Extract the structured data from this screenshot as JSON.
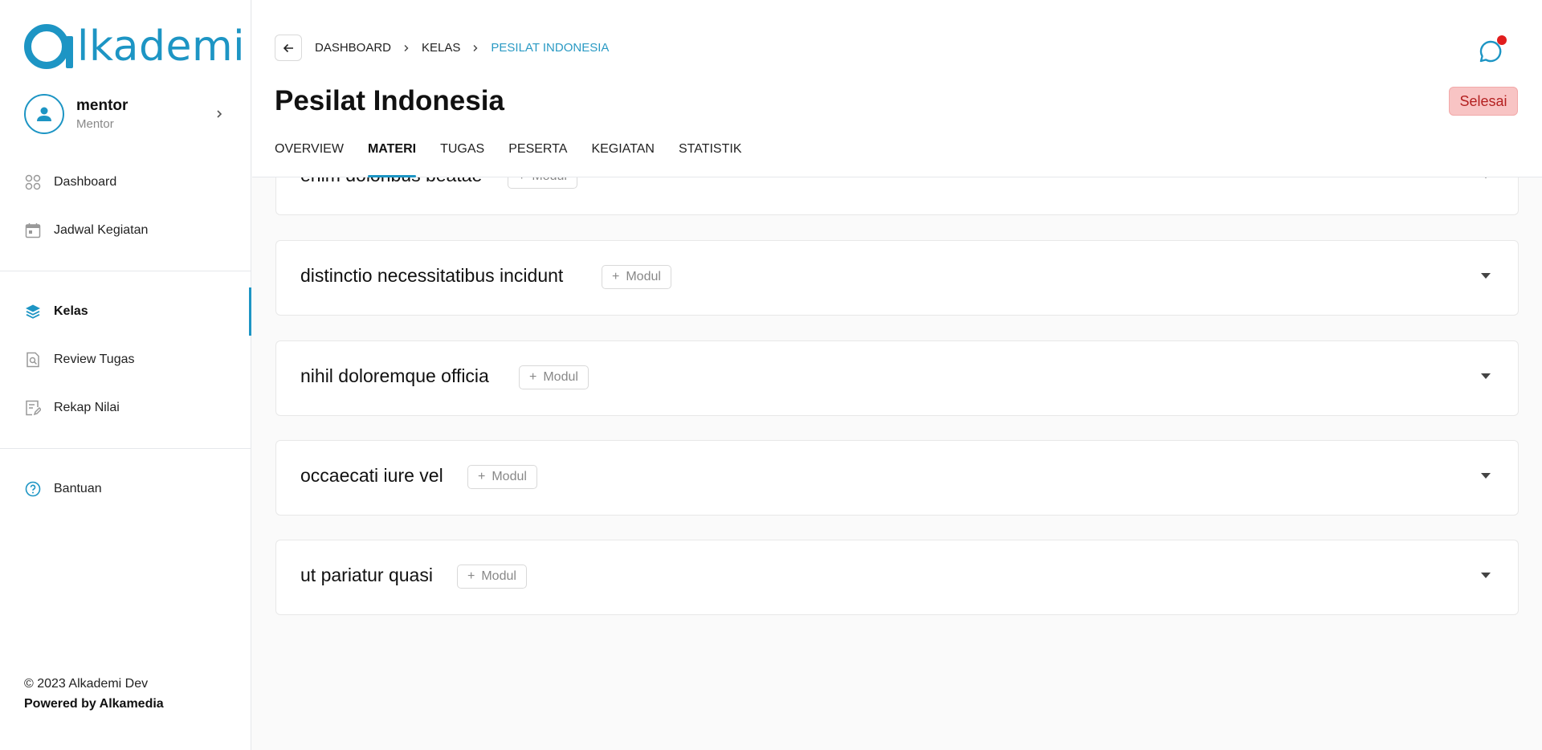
{
  "app": {
    "logo_text": "lkademi"
  },
  "user": {
    "name": "mentor",
    "role": "Mentor"
  },
  "sidebar": {
    "items": [
      {
        "label": "Dashboard",
        "icon": "grid-icon"
      },
      {
        "label": "Jadwal Kegiatan",
        "icon": "calendar-icon"
      },
      {
        "label": "Kelas",
        "icon": "layers-icon",
        "active": true
      },
      {
        "label": "Review Tugas",
        "icon": "search-document-icon"
      },
      {
        "label": "Rekap Nilai",
        "icon": "edit-document-icon"
      },
      {
        "label": "Bantuan",
        "icon": "help-circle-icon"
      }
    ],
    "footer_copy": "© 2023 Alkademi Dev",
    "footer_power": "Powered by Alkamedia"
  },
  "breadcrumb": [
    "DASHBOARD",
    "KELAS",
    "PESILAT INDONESIA"
  ],
  "page": {
    "title": "Pesilat Indonesia",
    "status": "Selesai"
  },
  "tabs": [
    "OVERVIEW",
    "MATERI",
    "TUGAS",
    "PESERTA",
    "KEGIATAN",
    "STATISTIK"
  ],
  "active_tab": "MATERI",
  "sections": [
    {
      "title": "enim doloribus beatae",
      "modul_label": "Modul"
    },
    {
      "title": "distinctio necessitatibus incidunt",
      "modul_label": "Modul"
    },
    {
      "title": "nihil doloremque officia",
      "modul_label": "Modul"
    },
    {
      "title": "occaecati iure vel",
      "modul_label": "Modul"
    },
    {
      "title": "ut pariatur quasi",
      "modul_label": "Modul"
    }
  ],
  "colors": {
    "accent": "#1d95c4",
    "status_bg": "#f8c4c4",
    "status_text": "#b42121",
    "notification": "#e11d1d"
  }
}
